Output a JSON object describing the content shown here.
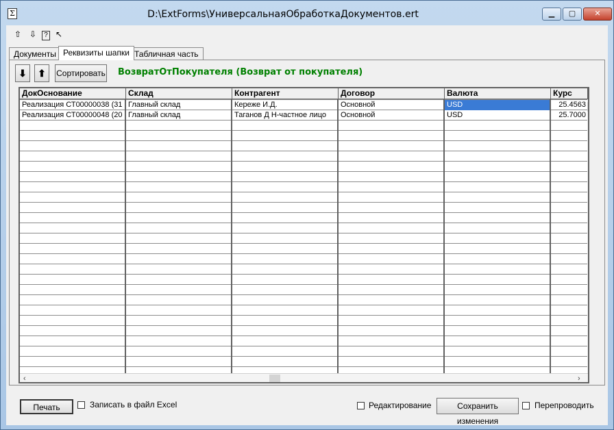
{
  "window": {
    "title": "D:\\ExtForms\\УниверсальнаяОбработкаДокументов.ert",
    "minimize": "▁",
    "maximize": "▢",
    "close": "✕"
  },
  "toolbar": {
    "icons": [
      "documents-up-icon",
      "documents-down-icon",
      "help-icon",
      "context-help-icon"
    ],
    "glyphs": [
      "⇧",
      "⇩",
      "?",
      "↖"
    ]
  },
  "tabs": [
    {
      "label": "Документы",
      "active": false
    },
    {
      "label": "Реквизиты шапки",
      "active": true
    },
    {
      "label": "Табличная часть",
      "active": false
    }
  ],
  "panel": {
    "down_button": "⬇",
    "up_button": "⬆",
    "sort_button": "Сортировать",
    "heading": "ВозвратОтПокупателя (Возврат от покупателя)"
  },
  "table": {
    "columns": [
      "ДокОснование",
      "Склад",
      "Контрагент",
      "Договор",
      "Валюта",
      "Курс"
    ],
    "rows": [
      [
        "Реализация  СТ00000038 (31",
        "Главный склад",
        "Кереже И.Д.",
        "Основной",
        "USD",
        "25.4563"
      ],
      [
        "Реализация  СТ00000048 (20",
        "Главный склад",
        "Таганов Д Н-частное лицо",
        "Основной",
        "USD",
        "25.7000"
      ]
    ],
    "selected_cell": {
      "row": 0,
      "col": 4
    }
  },
  "footer": {
    "print_button": "Печать",
    "excel_checkbox_label": "Записать в файл Excel",
    "edit_checkbox_label": "Редактирование",
    "save_button": "Сохранить изменения",
    "repost_checkbox_label": "Перепроводить"
  },
  "colors": {
    "heading": "#008000",
    "selection": "#3a7bd5"
  }
}
